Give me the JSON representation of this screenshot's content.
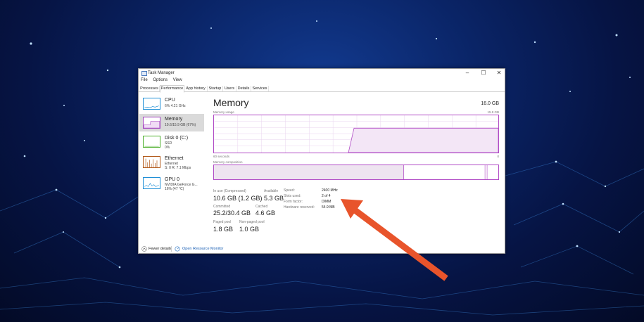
{
  "window": {
    "title": "Task Manager",
    "controls": {
      "minimize": "–",
      "maximize": "☐",
      "close": "✕"
    }
  },
  "menu": [
    "File",
    "Options",
    "View"
  ],
  "tabs": [
    "Processes",
    "Performance",
    "App history",
    "Startup",
    "Users",
    "Details",
    "Services"
  ],
  "active_tab": "Performance",
  "sidebar": {
    "items": [
      {
        "name": "CPU",
        "line1": "6% 4.21 GHz",
        "line2": "",
        "color": "#1f8fd6"
      },
      {
        "name": "Memory",
        "line1": "10.6/15.9 GB (67%)",
        "line2": "",
        "color": "#a445c0"
      },
      {
        "name": "Disk 0 (C:)",
        "line1": "SSD",
        "line2": "0%",
        "color": "#4caf2a"
      },
      {
        "name": "Ethernet",
        "line1": "Ethernet",
        "line2": "S: 0 R: 7.1 Mbps",
        "color": "#b25a1b"
      },
      {
        "name": "GPU 0",
        "line1": "NVIDIA GeForce G...",
        "line2": "16% (47 °C)",
        "color": "#1f8fd6"
      }
    ]
  },
  "main": {
    "title": "Memory",
    "total": "16.0 GB",
    "usage_label": "Memory usage",
    "usage_max": "15.9 GB",
    "time_label": "60 seconds",
    "time_end": "0",
    "composition_label": "Memory composition",
    "stats": {
      "in_use_label": "In use (Compressed)",
      "in_use": "10.6 GB (1.2 GB)",
      "available_label": "Available",
      "available": "5.3 GB",
      "committed_label": "Committed",
      "committed": "25.2/30.4 GB",
      "cached_label": "Cached",
      "cached": "4.6 GB",
      "paged_label": "Paged pool",
      "paged": "1.8 GB",
      "nonpaged_label": "Non-paged pool",
      "nonpaged": "1.0 GB"
    },
    "specs": [
      {
        "label": "Speed:",
        "value": "2400 MHz"
      },
      {
        "label": "Slots used:",
        "value": "2 of 4"
      },
      {
        "label": "Form factor:",
        "value": "DIMM"
      },
      {
        "label": "Hardware reserved:",
        "value": "54.9 MB"
      }
    ]
  },
  "footer": {
    "fewer_details": "Fewer details",
    "resource_monitor": "Open Resource Monitor"
  },
  "colors": {
    "memory_accent": "#b14bc6",
    "arrow": "#e8542b"
  }
}
